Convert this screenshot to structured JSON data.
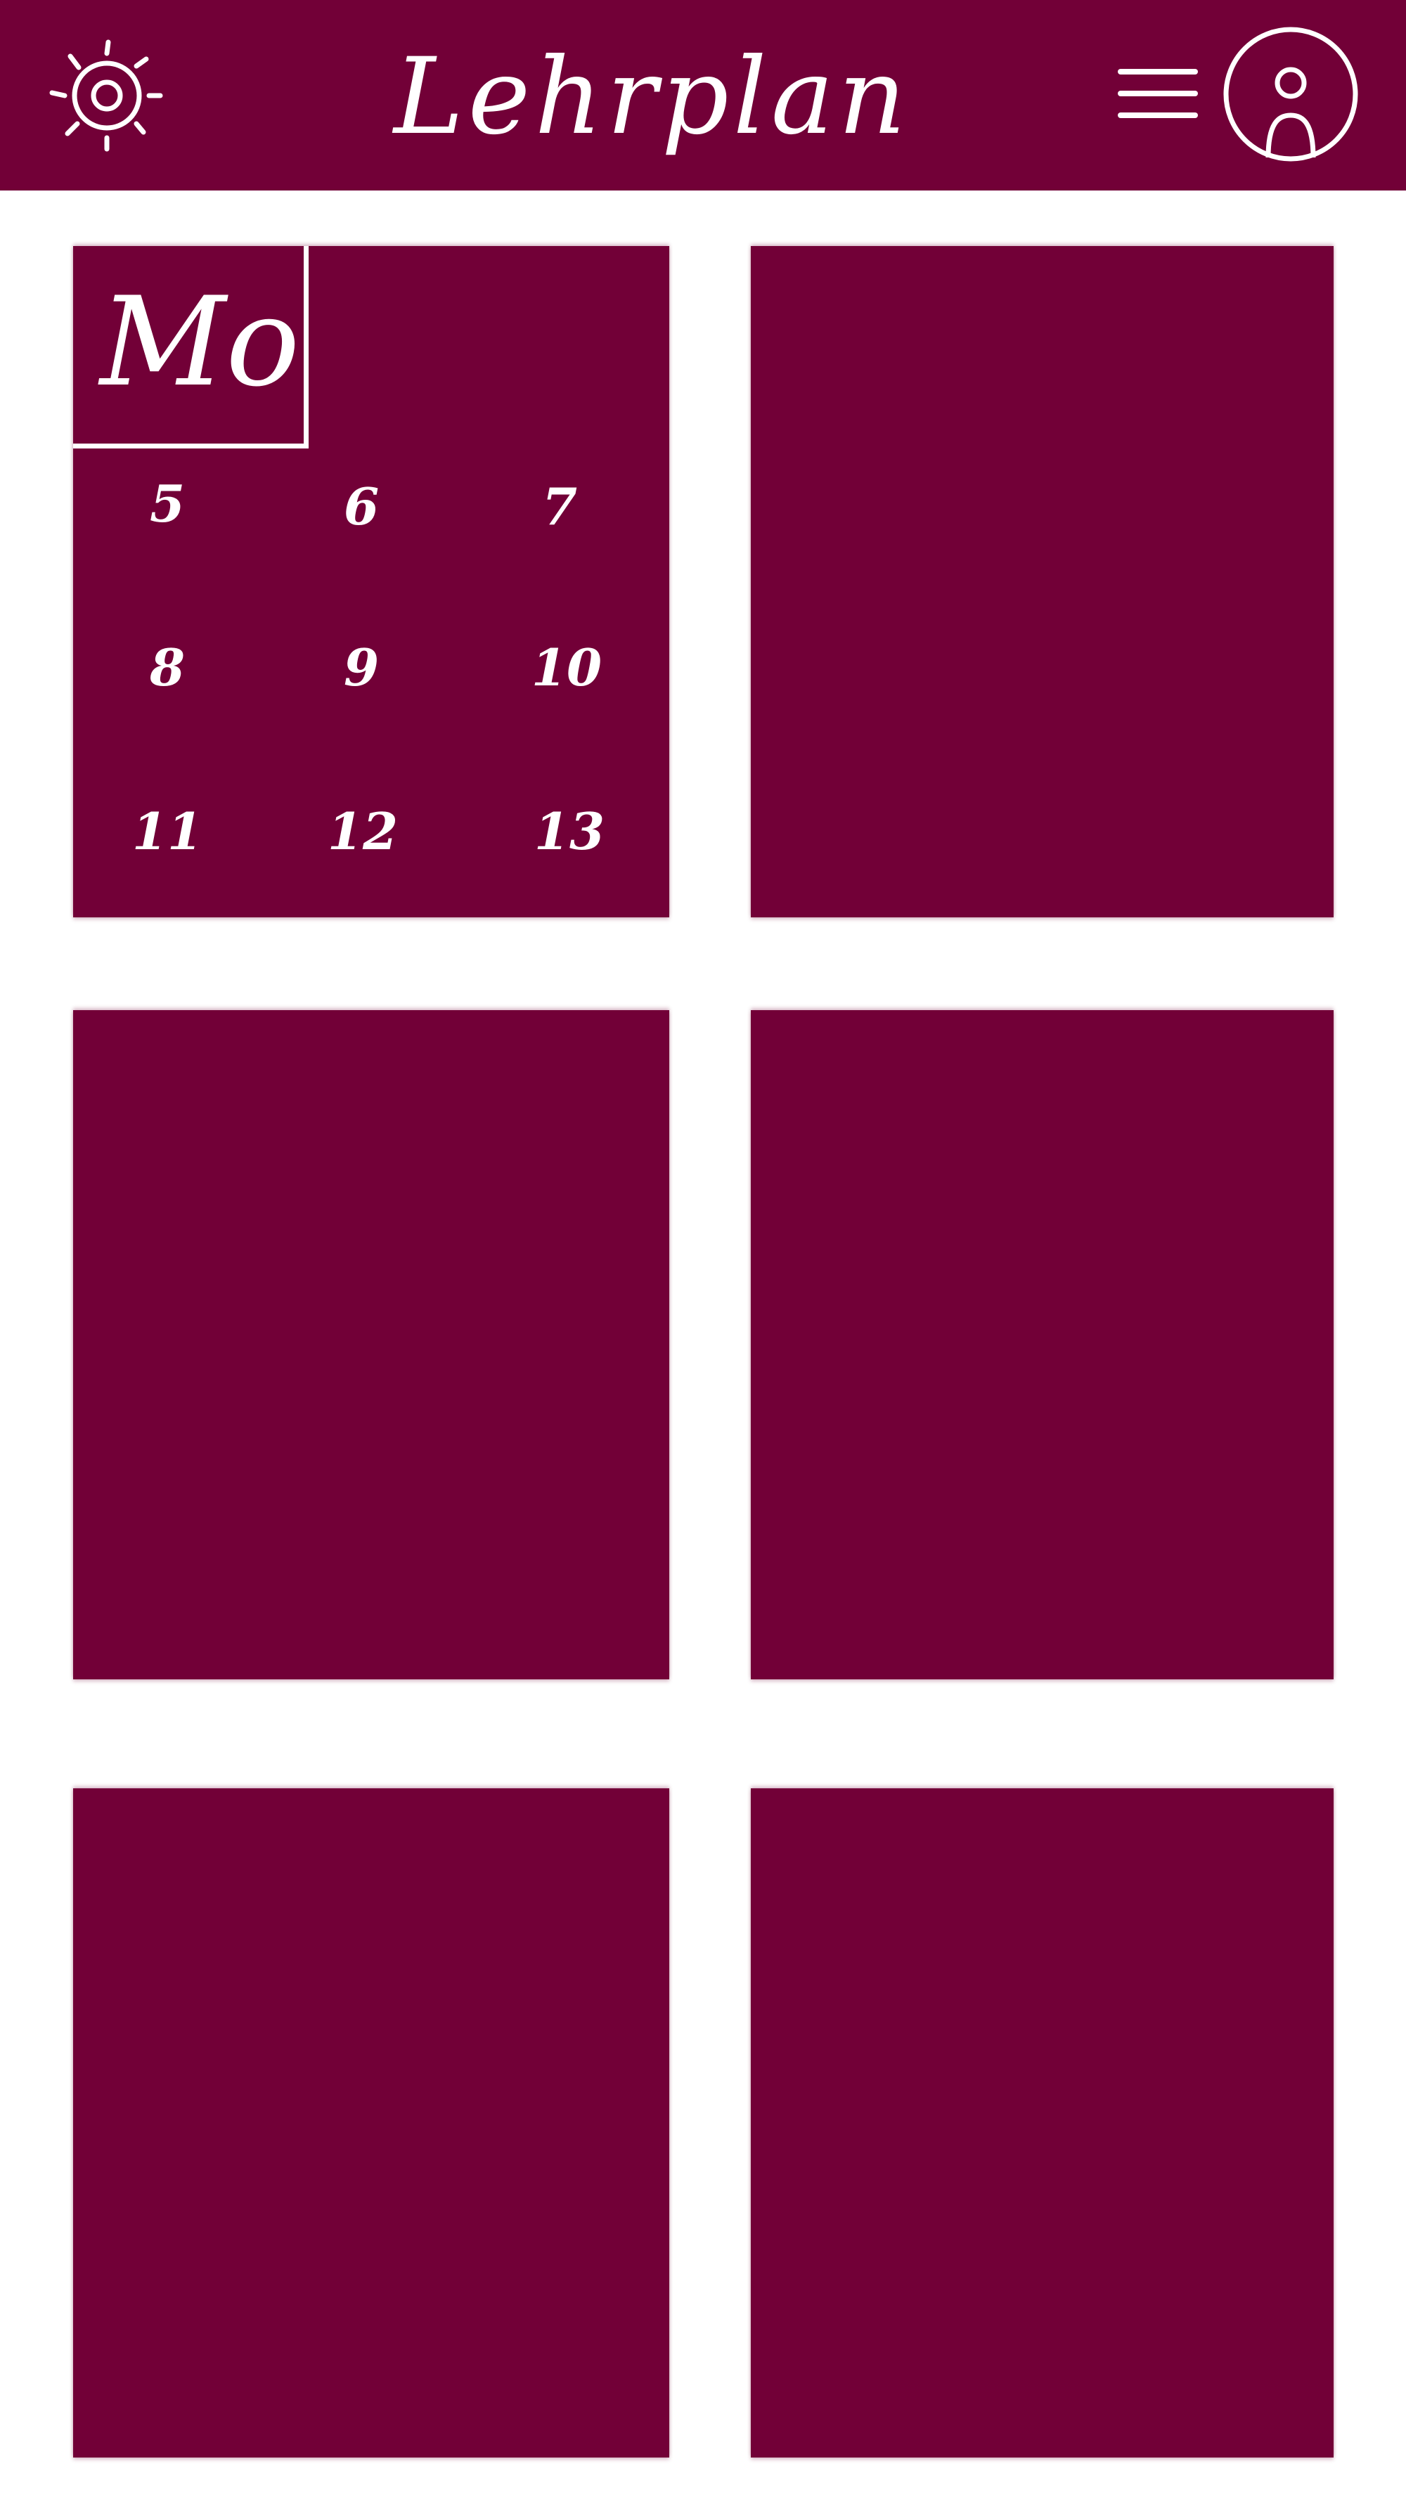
{
  "header": {
    "title": "Lehrplan",
    "settings_icon": "gear-icon",
    "menu_icon": "hamburger-menu-icon",
    "profile_icon": "user-profile-icon"
  },
  "colors": {
    "primary": "#720037",
    "background": "#ffffff",
    "foreground": "#ffffff"
  },
  "tiles": [
    {
      "day_label": "Mo",
      "numbers": [
        "5",
        "6",
        "7",
        "8",
        "9",
        "10",
        "11",
        "12",
        "13"
      ]
    },
    {},
    {},
    {},
    {},
    {}
  ]
}
